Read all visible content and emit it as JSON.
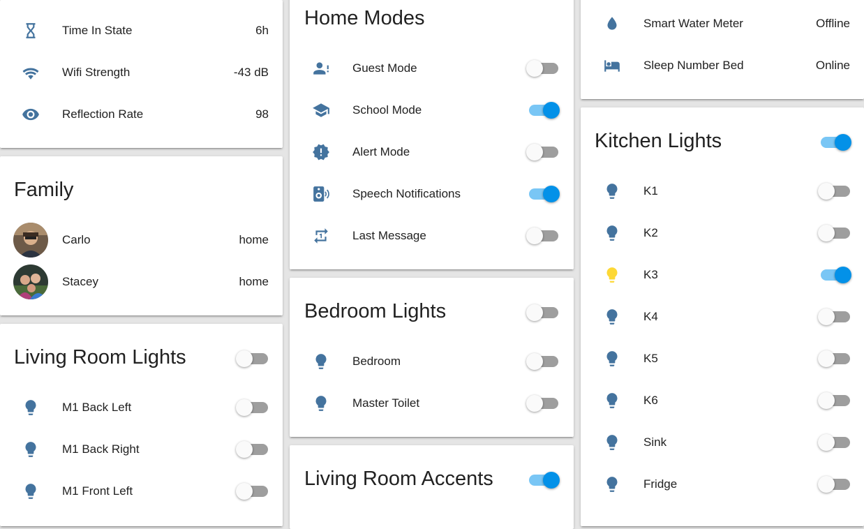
{
  "colors": {
    "icon": "#44739e",
    "icon_on": "#fdd835",
    "toggle_on": "#0391e8",
    "toggle_off": "#9e9e9e"
  },
  "sensors": [
    {
      "icon": "hourglass-icon",
      "label": "Time In State",
      "value": "6h"
    },
    {
      "icon": "wifi-icon",
      "label": "Wifi Strength",
      "value": "-43 dB"
    },
    {
      "icon": "eye-icon",
      "label": "Reflection Rate",
      "value": "98"
    }
  ],
  "family": {
    "title": "Family",
    "members": [
      {
        "name": "Carlo",
        "state": "home"
      },
      {
        "name": "Stacey",
        "state": "home"
      }
    ]
  },
  "living_room_lights": {
    "title": "Living Room Lights",
    "on": false,
    "items": [
      {
        "label": "M1 Back Left",
        "on": false
      },
      {
        "label": "M1 Back Right",
        "on": false
      },
      {
        "label": "M1 Front Left",
        "on": false
      }
    ]
  },
  "home_modes": {
    "title": "Home Modes",
    "items": [
      {
        "icon": "account-alert-icon",
        "label": "Guest Mode",
        "on": false
      },
      {
        "icon": "school-icon",
        "label": "School Mode",
        "on": true
      },
      {
        "icon": "alert-decagram-icon",
        "label": "Alert Mode",
        "on": false
      },
      {
        "icon": "speaker-wireless-icon",
        "label": "Speech Notifications",
        "on": true
      },
      {
        "icon": "repeat-once-icon",
        "label": "Last Message",
        "on": false
      }
    ]
  },
  "bedroom_lights": {
    "title": "Bedroom Lights",
    "on": false,
    "items": [
      {
        "label": "Bedroom",
        "on": false
      },
      {
        "label": "Master Toilet",
        "on": false
      }
    ]
  },
  "living_room_accents": {
    "title": "Living Room Accents",
    "on": true
  },
  "devices": [
    {
      "icon": "water-icon",
      "label": "Smart Water Meter",
      "value": "Offline"
    },
    {
      "icon": "bed-icon",
      "label": "Sleep Number Bed",
      "value": "Online"
    }
  ],
  "kitchen_lights": {
    "title": "Kitchen Lights",
    "on": true,
    "items": [
      {
        "label": "K1",
        "on": false
      },
      {
        "label": "K2",
        "on": false
      },
      {
        "label": "K3",
        "on": true
      },
      {
        "label": "K4",
        "on": false
      },
      {
        "label": "K5",
        "on": false
      },
      {
        "label": "K6",
        "on": false
      },
      {
        "label": "Sink",
        "on": false
      },
      {
        "label": "Fridge",
        "on": false
      }
    ]
  }
}
